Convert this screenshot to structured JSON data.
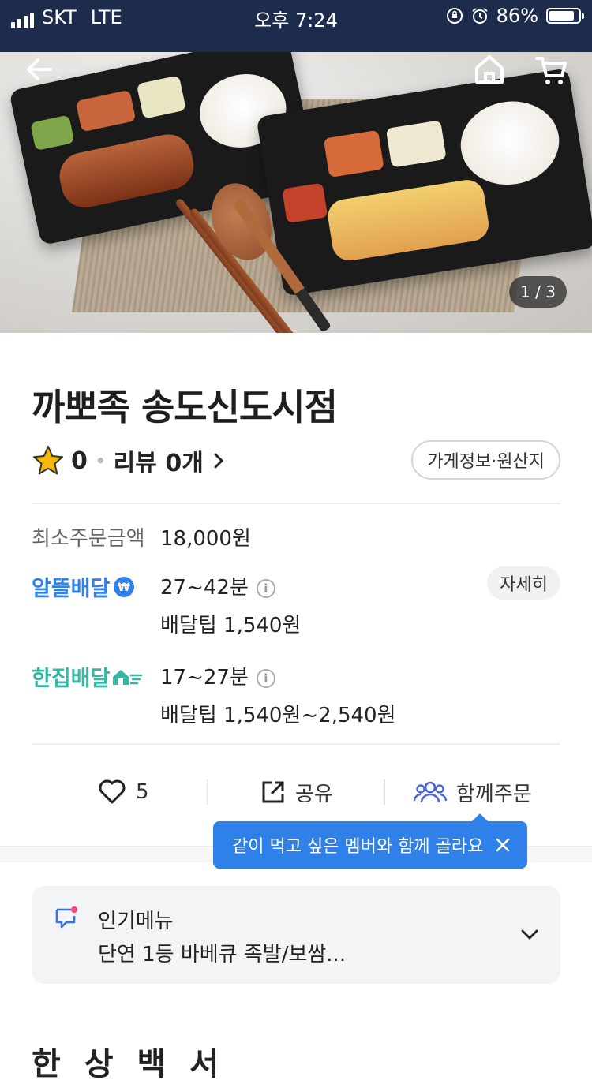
{
  "status_bar": {
    "carrier": "SKT",
    "network": "LTE",
    "time": "오후 7:24",
    "battery": "86%",
    "battery_level": 0.86
  },
  "hero": {
    "page_indicator": "1 / 3",
    "icons": [
      "back-arrow-icon",
      "home-icon",
      "cart-icon"
    ]
  },
  "store": {
    "name": "까뽀족 송도신도시점",
    "rating": "0",
    "review_label": "리뷰 0개",
    "info_button": "가게정보·원산지"
  },
  "order_info": {
    "min_order_label": "최소주문금액",
    "min_order_value": "18,000원",
    "economy_delivery": {
      "brand": "알뜰배달",
      "time": "27~42분",
      "tip": "배달팁 1,540원",
      "detail_button": "자세히"
    },
    "single_delivery": {
      "brand": "한집배달",
      "time": "17~27분",
      "tip": "배달팁 1,540원~2,540원"
    }
  },
  "actions": {
    "like_count": "5",
    "share_label": "공유",
    "group_order_label": "함께주문"
  },
  "tooltip": {
    "text": "같이 먹고 싶은 멤버와 함께 골라요"
  },
  "popular_menu": {
    "title": "인기메뉴",
    "description": "단연 1등 바베큐 족발/보쌈..."
  },
  "next_section_title": "한 상 백 서",
  "colors": {
    "status_bar_bg": "#1d2c4c",
    "brand_blue": "#2f80e8",
    "brand_teal": "#35b7a6",
    "star": "#f5b90a"
  }
}
